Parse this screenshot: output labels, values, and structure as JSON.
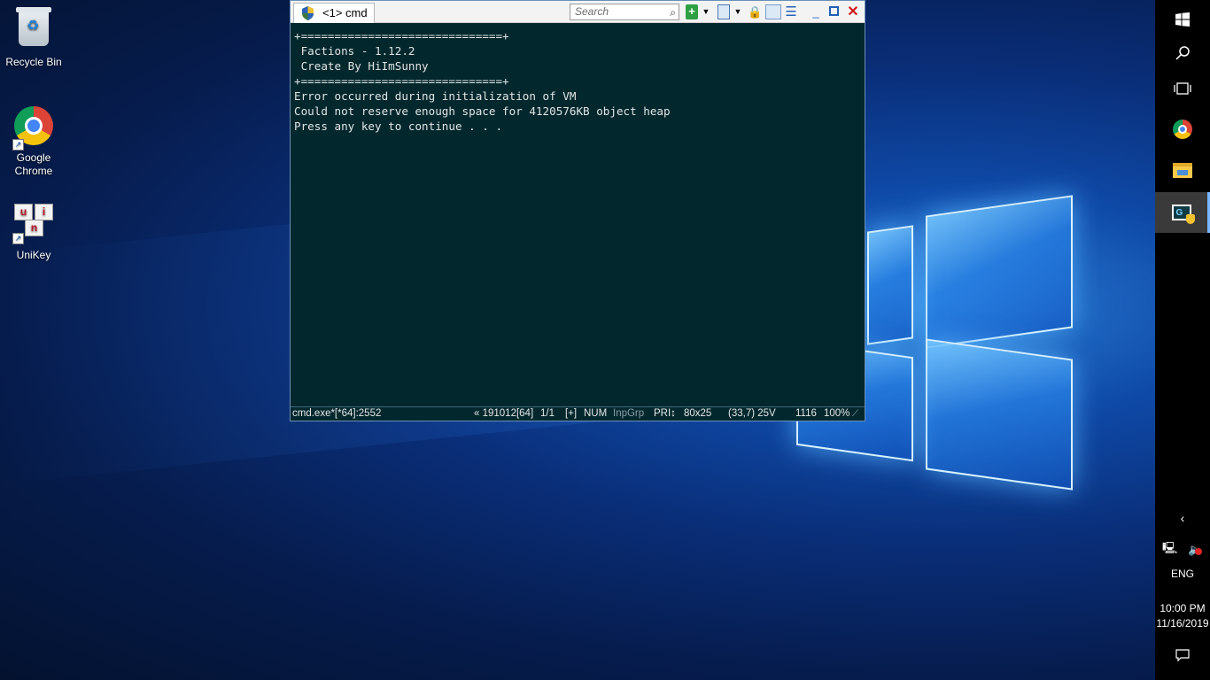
{
  "desktop": {
    "icons": [
      {
        "label": "Recycle Bin",
        "icon": "recycle-bin-icon"
      },
      {
        "label": "Google Chrome",
        "icon": "chrome-icon"
      },
      {
        "label": "UniKey",
        "icon": "unikey-icon",
        "keys": [
          "u",
          "i",
          "n"
        ]
      }
    ]
  },
  "console_window": {
    "tab_label": "<1> cmd",
    "tab_icon": "uac-shield-icon",
    "search_placeholder": "Search",
    "lines": [
      "+==============================+",
      " Factions - 1.12.2",
      " Create By HiImSunny",
      "+==============================+",
      "Error occurred during initialization of VM",
      "Could not reserve enough space for 4120576KB object heap",
      "Press any key to continue . . ."
    ],
    "status": {
      "process": "cmd.exe*[*64]:2552",
      "build": "« 191012[64]",
      "page": "1/1",
      "plus": "[+]",
      "num": "NUM",
      "inpgrp": "InpGrp",
      "pri": "PRI↕",
      "size": "80x25",
      "cursor": "(33,7) 25V",
      "pid": "1116",
      "zoom": "100%"
    },
    "colors": {
      "background": "#02282e",
      "text": "#e4e4e4"
    }
  },
  "taskbar": {
    "items": [
      "start-icon",
      "search-icon",
      "task-view-icon",
      "chrome-icon",
      "file-explorer-icon",
      "conemu-icon"
    ],
    "tray": {
      "language": "ENG",
      "time": "10:00 PM",
      "date": "11/16/2019"
    }
  }
}
